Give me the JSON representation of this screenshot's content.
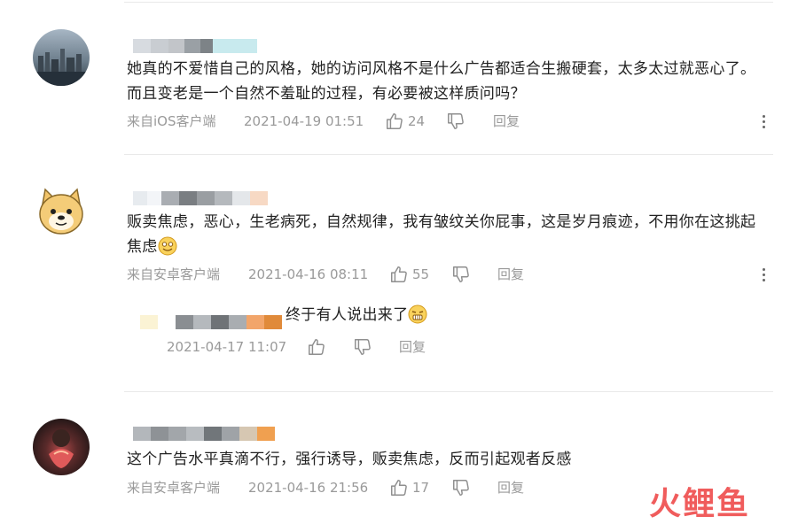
{
  "comments": [
    {
      "text": "她真的不爱惜自己的风格，她的访问风格不是什么广告都适合生搬硬套，太多太过就恶心了。而且变老是一个自然不羞耻的过程，有必要被这样质问吗？",
      "source": "来自iOS客户端",
      "time": "2021-04-19 01:51",
      "likes": "24",
      "reply_label": "回复",
      "name_colors": [
        "#d7dbe0",
        "#c9cdd2",
        "#c2c5c9",
        "#9aa0a5",
        "#7d8387",
        "#c8eaee",
        "#c8eaee",
        "#c8eaee"
      ]
    },
    {
      "text": "贩卖焦虑，恶心，生老病死，自然规律，我有皱纹关你屁事，这是岁月痕迹，不用你在这挑起焦虑",
      "source": "来自安卓客户端",
      "time": "2021-04-16 08:11",
      "likes": "55",
      "reply_label": "回复",
      "name_colors": [
        "#e7ebef",
        "#f3f5f8",
        "#a9adb2",
        "#7a7e82",
        "#9a9ea2",
        "#b5b9bd",
        "#e4e7ea",
        "#f7d9c4"
      ]
    },
    {
      "text": "这个广告水平真滴不行，强行诱导，贩卖焦虑，反而引起观者反感",
      "source": "来自安卓客户端",
      "time": "2021-04-16 21:56",
      "likes": "17",
      "reply_label": "回复",
      "name_colors": [
        "#b3b7bb",
        "#8e9296",
        "#a2a6aa",
        "#b8bcc0",
        "#71767a",
        "#9fa3a7",
        "#d6c7b2",
        "#f0a050"
      ]
    }
  ],
  "reply": {
    "text": "终于有人说出来了",
    "time": "2021-04-17 11:07",
    "reply_label": "回复",
    "name_colors": [
      "#fbf3d4",
      "#ffffff",
      "#8a8e92",
      "#b5b9bd",
      "#6f7377",
      "#a9adb1",
      "#f2a56a",
      "#e08a3a"
    ]
  },
  "watermark": "火鲤鱼",
  "icons": [
    "thumbs-up-icon",
    "thumbs-down-icon",
    "more-vertical-icon",
    "smile-emoji-icon",
    "grimace-emoji-icon"
  ]
}
